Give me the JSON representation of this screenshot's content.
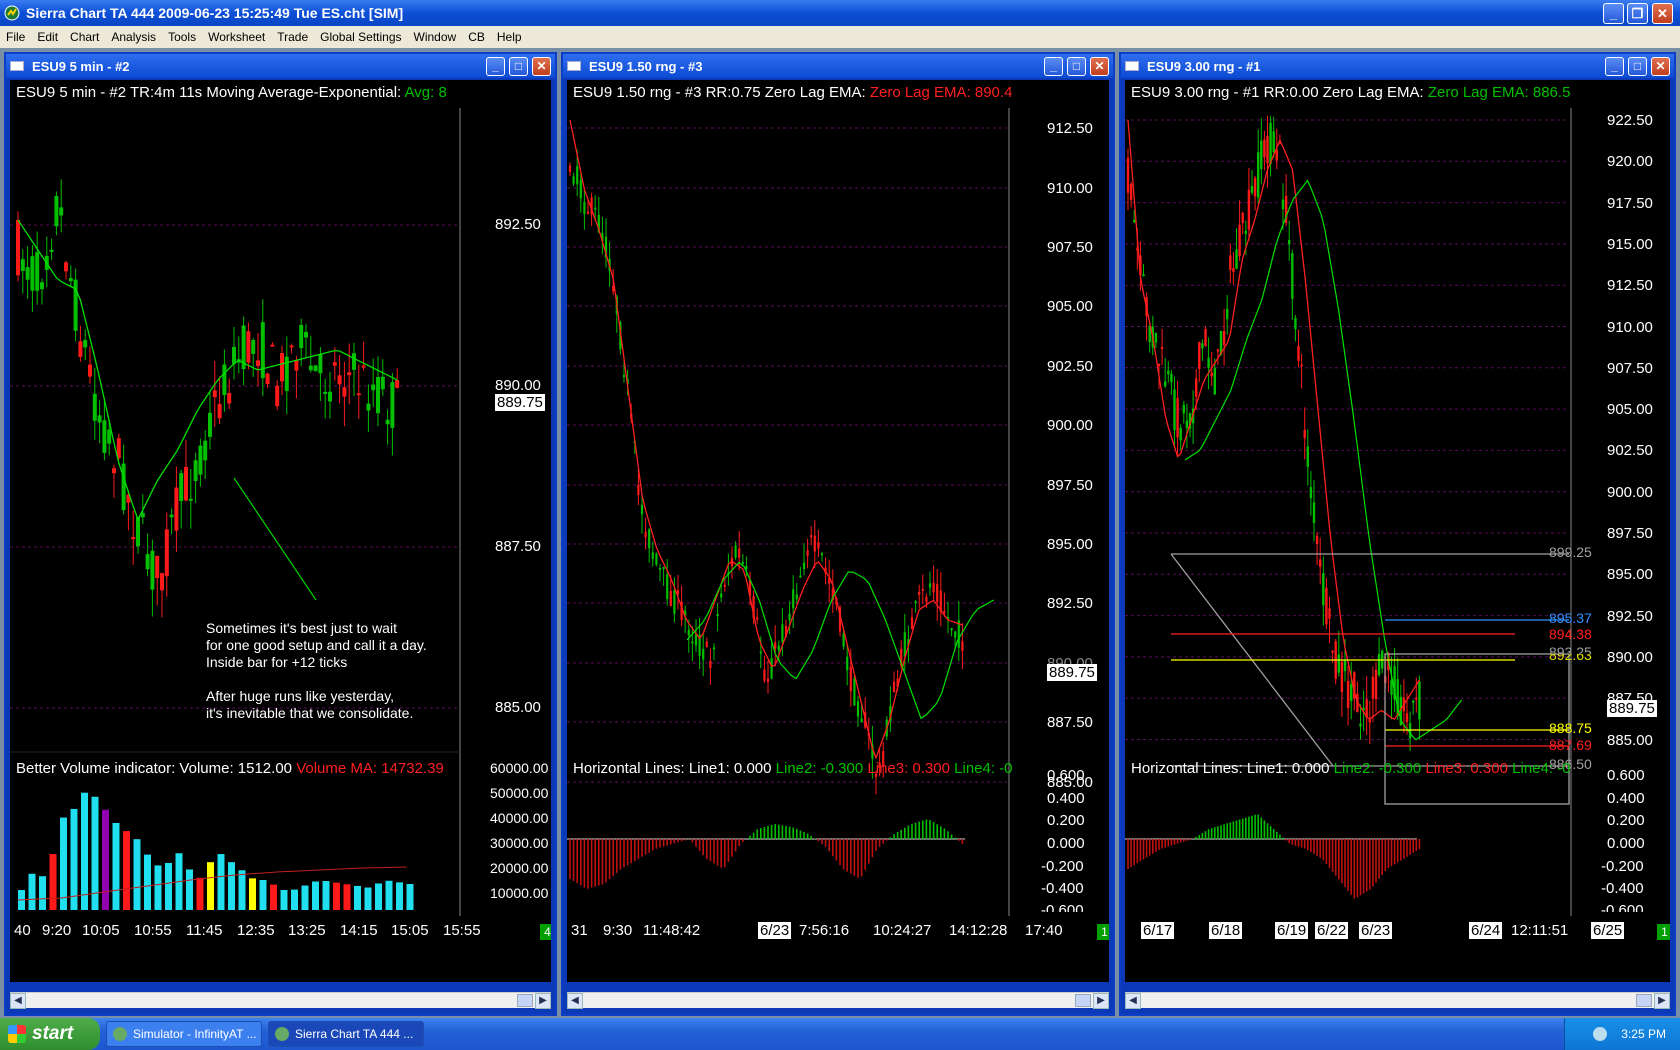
{
  "window": {
    "title": "Sierra Chart TA 444  2009-06-23  15:25:49  Tue    ES.cht [SIM]"
  },
  "menu": [
    "File",
    "Edit",
    "Chart",
    "Analysis",
    "Tools",
    "Worksheet",
    "Trade",
    "Global Settings",
    "Window",
    "CB",
    "Help"
  ],
  "charts": [
    {
      "window_title": "ESU9  5 min  - #2",
      "header_main": "ESU9  5 min  - #2  TR:4m 11s  Moving Average-Exponential:",
      "header_green": "Avg: 8",
      "price_labels": [
        "892.50",
        "890.00",
        "887.50",
        "885.00"
      ],
      "current_price": "889.75",
      "annotation": "Sometimes it's best just to wait\nfor one good setup and call it a day.\nInside bar for +12 ticks\n\nAfter huge runs like yesterday,\nit's inevitable that we consolidate.",
      "lower_header_main": "Better Volume indicator:  Volume: 1512.00",
      "lower_header_red": "Volume MA: 14732.39",
      "lower_labels": [
        "60000.00",
        "50000.00",
        "40000.00",
        "30000.00",
        "20000.00",
        "10000.00"
      ],
      "x_labels": [
        "40",
        "9:20",
        "10:05",
        "10:55",
        "11:45",
        "12:35",
        "13:25",
        "14:15",
        "15:05",
        "15:55"
      ],
      "badge": "4"
    },
    {
      "window_title": "ESU9  1.50 rng - #3",
      "header_main": "ESU9  1.50 rng - #3  RR:0.75  Zero Lag EMA:",
      "header_red": "Zero Lag EMA: 890.4",
      "price_labels": [
        "912.50",
        "910.00",
        "907.50",
        "905.00",
        "902.50",
        "900.00",
        "897.50",
        "895.00",
        "892.50",
        "890.00",
        "887.50",
        "885.00"
      ],
      "current_price": "889.75",
      "lower_header_main": "Horizontal Lines:  Line1: 0.000",
      "lower_header_green": "Line2: -0.300",
      "lower_header_red": "Line3: 0.300",
      "lower_header_green2": "Line4: -0",
      "lower_labels": [
        "0.600",
        "0.400",
        "0.200",
        "0.000",
        "-0.200",
        "-0.400",
        "-0.600"
      ],
      "x_labels": [
        "31",
        "9:30",
        "11:48:42",
        "6/23",
        "7:56:16",
        "10:24:27",
        "14:12:28",
        "17:40"
      ],
      "badge": "1"
    },
    {
      "window_title": "ESU9  3.00 rng - #1",
      "header_main": "ESU9  3.00 rng - #1  RR:0.00  Zero Lag EMA:",
      "header_green": "Zero Lag EMA: 886.5",
      "price_labels": [
        "922.50",
        "920.00",
        "917.50",
        "915.00",
        "912.50",
        "910.00",
        "907.50",
        "905.00",
        "902.50",
        "900.00",
        "897.50",
        "895.00",
        "892.50",
        "890.00",
        "887.50",
        "885.00"
      ],
      "current_price": "889.75",
      "levels": [
        {
          "text": "899.25",
          "color": "#a0a0a0"
        },
        {
          "text": "895.37",
          "color": "#3090ff"
        },
        {
          "text": "894.38",
          "color": "#ff2020"
        },
        {
          "text": "893.25",
          "color": "#a0a0a0"
        },
        {
          "text": "892.63",
          "color": "#e0e000"
        },
        {
          "text": "888.75",
          "color": "#ffff00"
        },
        {
          "text": "887.69",
          "color": "#ff2020"
        },
        {
          "text": "886.50",
          "color": "#a0a0a0"
        }
      ],
      "lower_header_main": "Horizontal Lines:  Line1: 0.000",
      "lower_header_green": "Line2: -0.300",
      "lower_header_red": "Line3: 0.300",
      "lower_header_green2": "Line4: -0",
      "lower_labels": [
        "0.600",
        "0.400",
        "0.200",
        "0.000",
        "-0.200",
        "-0.400",
        "-0.600"
      ],
      "x_labels": [
        "6/17",
        "6/18",
        "6/19",
        "6/22",
        "6/23",
        "6/24",
        "12:11:51",
        "6/25"
      ],
      "badge": "1"
    }
  ],
  "taskbar": {
    "start": "start",
    "tasks": [
      "Simulator - InfinityAT ...",
      "Sierra Chart TA 444  ..."
    ],
    "clock": "3:25 PM"
  },
  "colors": {
    "up": "#00c000",
    "down": "#ff1a1a",
    "ema": "#00e000",
    "background": "#000000"
  }
}
